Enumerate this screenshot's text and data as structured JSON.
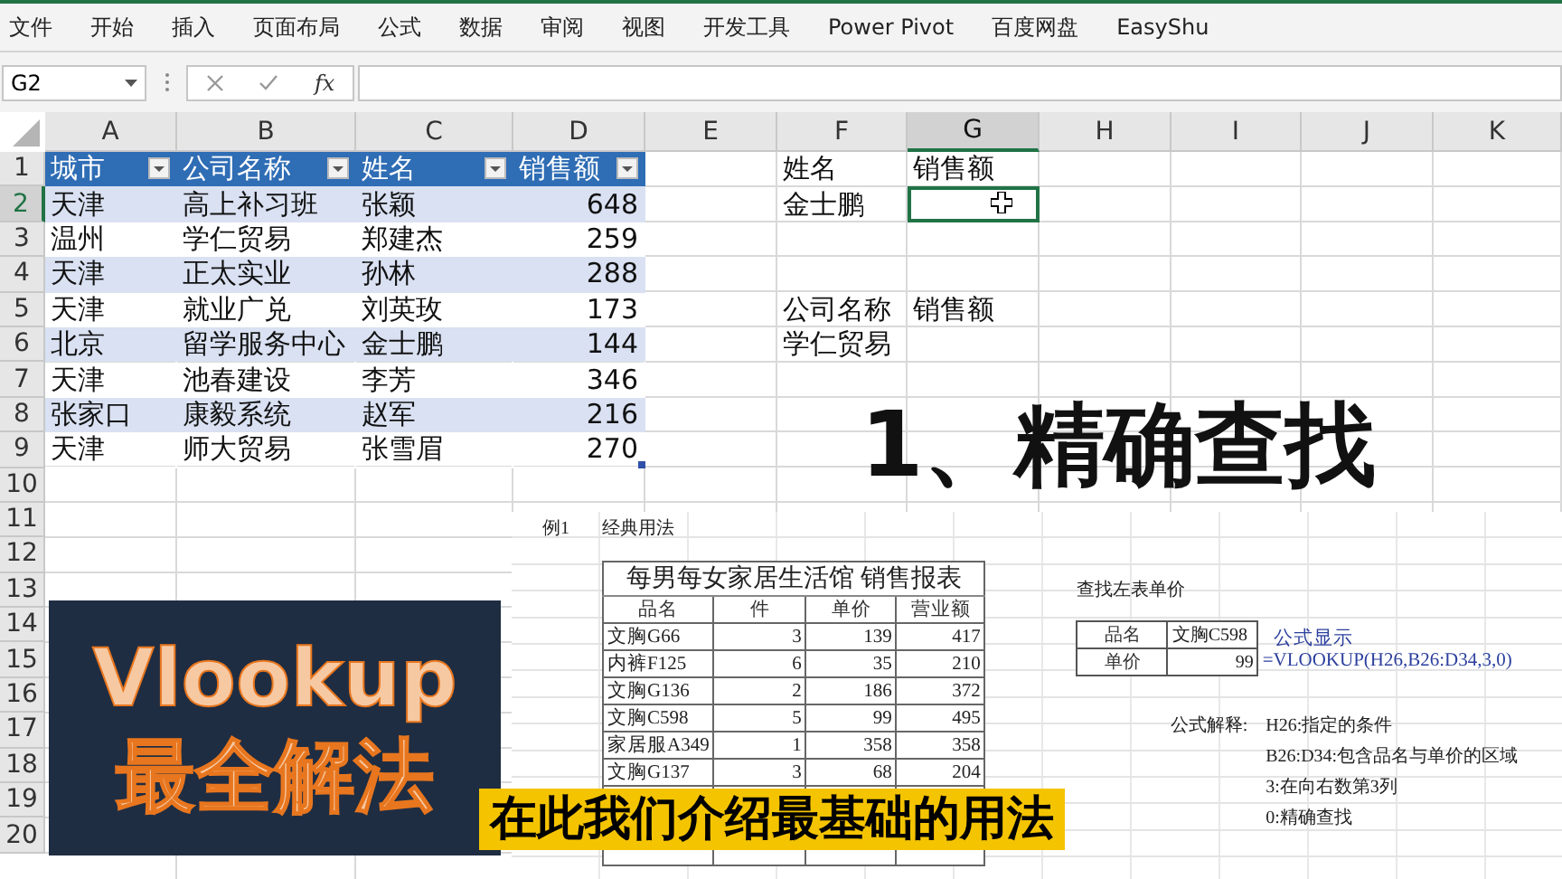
{
  "menu_tabs": [
    "文件",
    "开始",
    "插入",
    "页面布局",
    "公式",
    "数据",
    "审阅",
    "视图",
    "开发工具",
    "Power Pivot",
    "百度网盘",
    "EasyShu"
  ],
  "formula_bar": {
    "name_box": "G2",
    "function_label": "fx"
  },
  "columns": [
    {
      "label": "A",
      "selected": false
    },
    {
      "label": "B",
      "selected": false
    },
    {
      "label": "C",
      "selected": false
    },
    {
      "label": "D",
      "selected": false
    },
    {
      "label": "E",
      "selected": false
    },
    {
      "label": "F",
      "selected": false
    },
    {
      "label": "G",
      "selected": true
    },
    {
      "label": "H",
      "selected": false
    },
    {
      "label": "I",
      "selected": false
    },
    {
      "label": "J",
      "selected": false
    },
    {
      "label": "K",
      "selected": false
    }
  ],
  "row_numbers": [
    {
      "label": "1",
      "selected": false
    },
    {
      "label": "2",
      "selected": true
    },
    {
      "label": "3",
      "selected": false
    },
    {
      "label": "4",
      "selected": false
    },
    {
      "label": "5",
      "selected": false
    },
    {
      "label": "6",
      "selected": false
    },
    {
      "label": "7",
      "selected": false
    },
    {
      "label": "8",
      "selected": false
    },
    {
      "label": "9",
      "selected": false
    },
    {
      "label": "10",
      "selected": false
    },
    {
      "label": "11",
      "selected": false
    },
    {
      "label": "12",
      "selected": false
    },
    {
      "label": "13",
      "selected": false
    },
    {
      "label": "14",
      "selected": false
    },
    {
      "label": "15",
      "selected": false
    },
    {
      "label": "16",
      "selected": false
    },
    {
      "label": "17",
      "selected": false
    },
    {
      "label": "18",
      "selected": false
    },
    {
      "label": "19",
      "selected": false
    },
    {
      "label": "20",
      "selected": false
    }
  ],
  "table": {
    "headers": [
      "城市",
      "公司名称",
      "姓名",
      "销售额"
    ],
    "rows": [
      [
        "天津",
        "高上补习班",
        "张颖",
        "648"
      ],
      [
        "温州",
        "学仁贸易",
        "郑建杰",
        "259"
      ],
      [
        "天津",
        "正太实业",
        "孙林",
        "288"
      ],
      [
        "天津",
        "就业广兑",
        "刘英玫",
        "173"
      ],
      [
        "北京",
        "留学服务中心",
        "金士鹏",
        "144"
      ],
      [
        "天津",
        "池春建设",
        "李芳",
        "346"
      ],
      [
        "张家口",
        "康毅系统",
        "赵军",
        "216"
      ],
      [
        "天津",
        "师大贸易",
        "张雪眉",
        "270"
      ]
    ]
  },
  "lookup_blocks": [
    {
      "headers": [
        "姓名",
        "销售额"
      ],
      "values": [
        "金士鹏"
      ]
    },
    {
      "headers": [
        "公司名称",
        "销售额"
      ],
      "values": [
        "学仁贸易"
      ]
    }
  ],
  "headline": "1、精确查找",
  "title_card": [
    "Vlookup",
    "最全解法"
  ],
  "caption": "在此我们介绍最基础的用法",
  "pasted_sheet": {
    "example_label": "例1",
    "example_title": "经典用法",
    "report": {
      "title": "每男每女家居生活馆  销售报表",
      "columns": [
        "品名",
        "件",
        "单价",
        "营业额"
      ],
      "rows": [
        [
          "文胸G66",
          "3",
          "139",
          "417"
        ],
        [
          "内裤F125",
          "6",
          "35",
          "210"
        ],
        [
          "文胸G136",
          "2",
          "186",
          "372"
        ],
        [
          "文胸C598",
          "5",
          "99",
          "495"
        ],
        [
          "家居服A349",
          "1",
          "358",
          "358"
        ],
        [
          "文胸G137",
          "3",
          "68",
          "204"
        ]
      ]
    },
    "lookup": {
      "title": "查找左表单价",
      "rows": [
        {
          "label": "品名",
          "value": "文胸C598"
        },
        {
          "label": "单价",
          "value": "99"
        }
      ],
      "formula_caption": "公式显示",
      "formula": "=VLOOKUP(H26,B26:D34,3,0)",
      "explain_label": "公式解释:",
      "explanations": [
        "H26:指定的条件",
        "B26:D34:包含品名与单价的区域",
        "3:在向右数第3列",
        "0:精确查找"
      ]
    }
  }
}
